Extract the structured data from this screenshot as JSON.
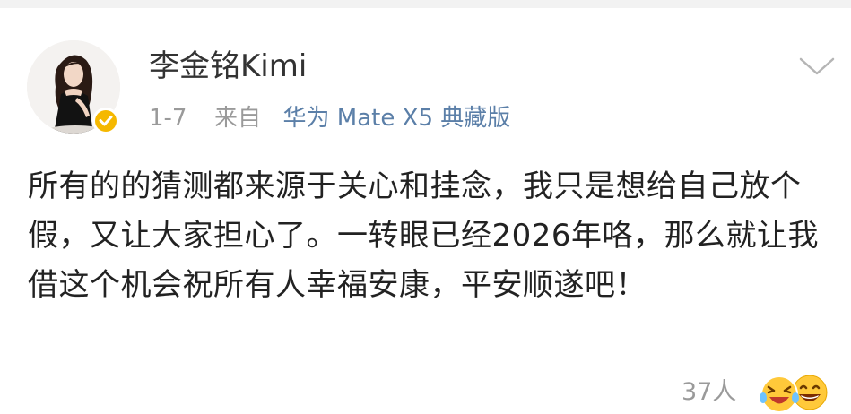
{
  "post": {
    "author_name": "李金铭Kimi",
    "date": "1-7",
    "source_prefix": "来自",
    "source_device": "华为 Mate X5 典藏版",
    "body": "所有的的猜测都来源于关心和挂念，我只是想给自己放个假，又让大家担心了。一转眼已经2026年咯，那么就让我借这个机会祝所有人幸福安康，平安顺遂吧！",
    "reaction_count": "37人"
  },
  "icons": {
    "avatar": "avatar-photo",
    "badge": "verified-badge-icon",
    "menu": "chevron-down-icon",
    "reactions": [
      "laughing-tears-emoji-icon",
      "grinning-emoji-icon"
    ]
  },
  "colors": {
    "link": "#5b7fa8",
    "badge": "#f5b800",
    "muted": "#9a9a9a",
    "text": "#222222"
  }
}
